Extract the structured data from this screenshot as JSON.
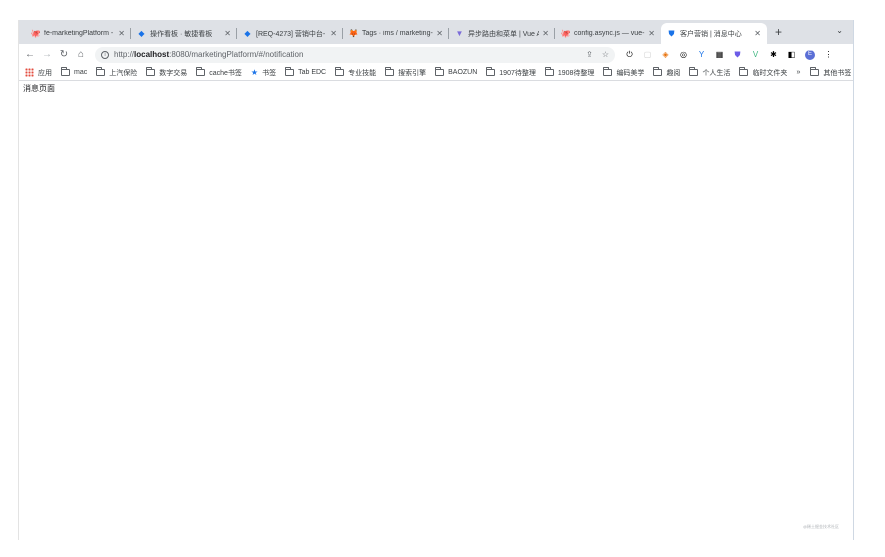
{
  "tabs": [
    {
      "favicon": "github-icon",
      "title": "fe-marketingPlatform -",
      "active": false
    },
    {
      "favicon": "diamond-icon",
      "title": "操作看板 · 敏捷看板",
      "active": false
    },
    {
      "favicon": "diamond-icon",
      "title": "[REQ-4273] 营销中台-",
      "active": false
    },
    {
      "favicon": "gitlab-icon",
      "title": "Tags · ims / marketing-",
      "active": false
    },
    {
      "favicon": "vue-icon",
      "title": "异步路由和菜单 | Vue Ad",
      "active": false
    },
    {
      "favicon": "github-icon",
      "title": "config.async.js — vue-",
      "active": false
    },
    {
      "favicon": "shield-icon",
      "title": "客户营销 | 消息中心",
      "active": true
    }
  ],
  "toolbar": {
    "url_scheme": "http://",
    "url_host": "localhost",
    "url_rest": ":8080/marketingPlatform/#/notification",
    "avatar_letter": "E"
  },
  "bookmarks": [
    {
      "icon": "apps-icon",
      "label": "应用"
    },
    {
      "icon": "folder-icon",
      "label": "mac"
    },
    {
      "icon": "folder-icon",
      "label": "上汽保险"
    },
    {
      "icon": "folder-icon",
      "label": "数字交易"
    },
    {
      "icon": "folder-icon",
      "label": "cache书签"
    },
    {
      "icon": "star-icon",
      "label": "书签"
    },
    {
      "icon": "folder-icon",
      "label": "Tab EDC"
    },
    {
      "icon": "folder-icon",
      "label": "专业技能"
    },
    {
      "icon": "folder-icon",
      "label": "搜索引擎"
    },
    {
      "icon": "folder-icon",
      "label": "BAOZUN"
    },
    {
      "icon": "folder-icon",
      "label": "1907待整理"
    },
    {
      "icon": "folder-icon",
      "label": "1908待整理"
    },
    {
      "icon": "folder-icon",
      "label": "编码美学"
    },
    {
      "icon": "folder-icon",
      "label": "趣阅"
    },
    {
      "icon": "folder-icon",
      "label": "个人生活"
    },
    {
      "icon": "folder-icon",
      "label": "临时文件夹"
    }
  ],
  "bookmarks_overflow": "»",
  "other_bookmarks": "其他书签",
  "page": {
    "text": "消息页面",
    "watermark": "@稀土掘金技术社区"
  }
}
